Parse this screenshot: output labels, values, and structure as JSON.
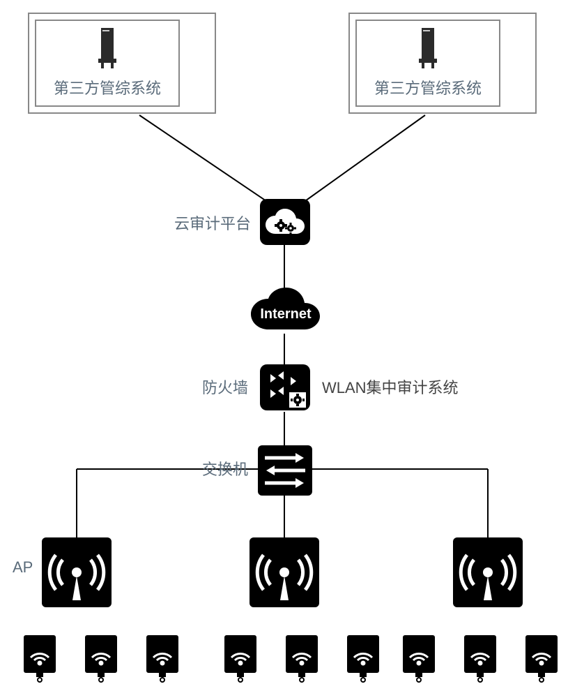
{
  "thirdParty": {
    "left": "第三方管综系统",
    "right": "第三方管综系统"
  },
  "cloudAudit": "云审计平台",
  "internet": "Internet",
  "firewall": "防火墙",
  "wlanAudit": "WLAN集中审计系统",
  "switch": "交换机",
  "ap": "AP"
}
